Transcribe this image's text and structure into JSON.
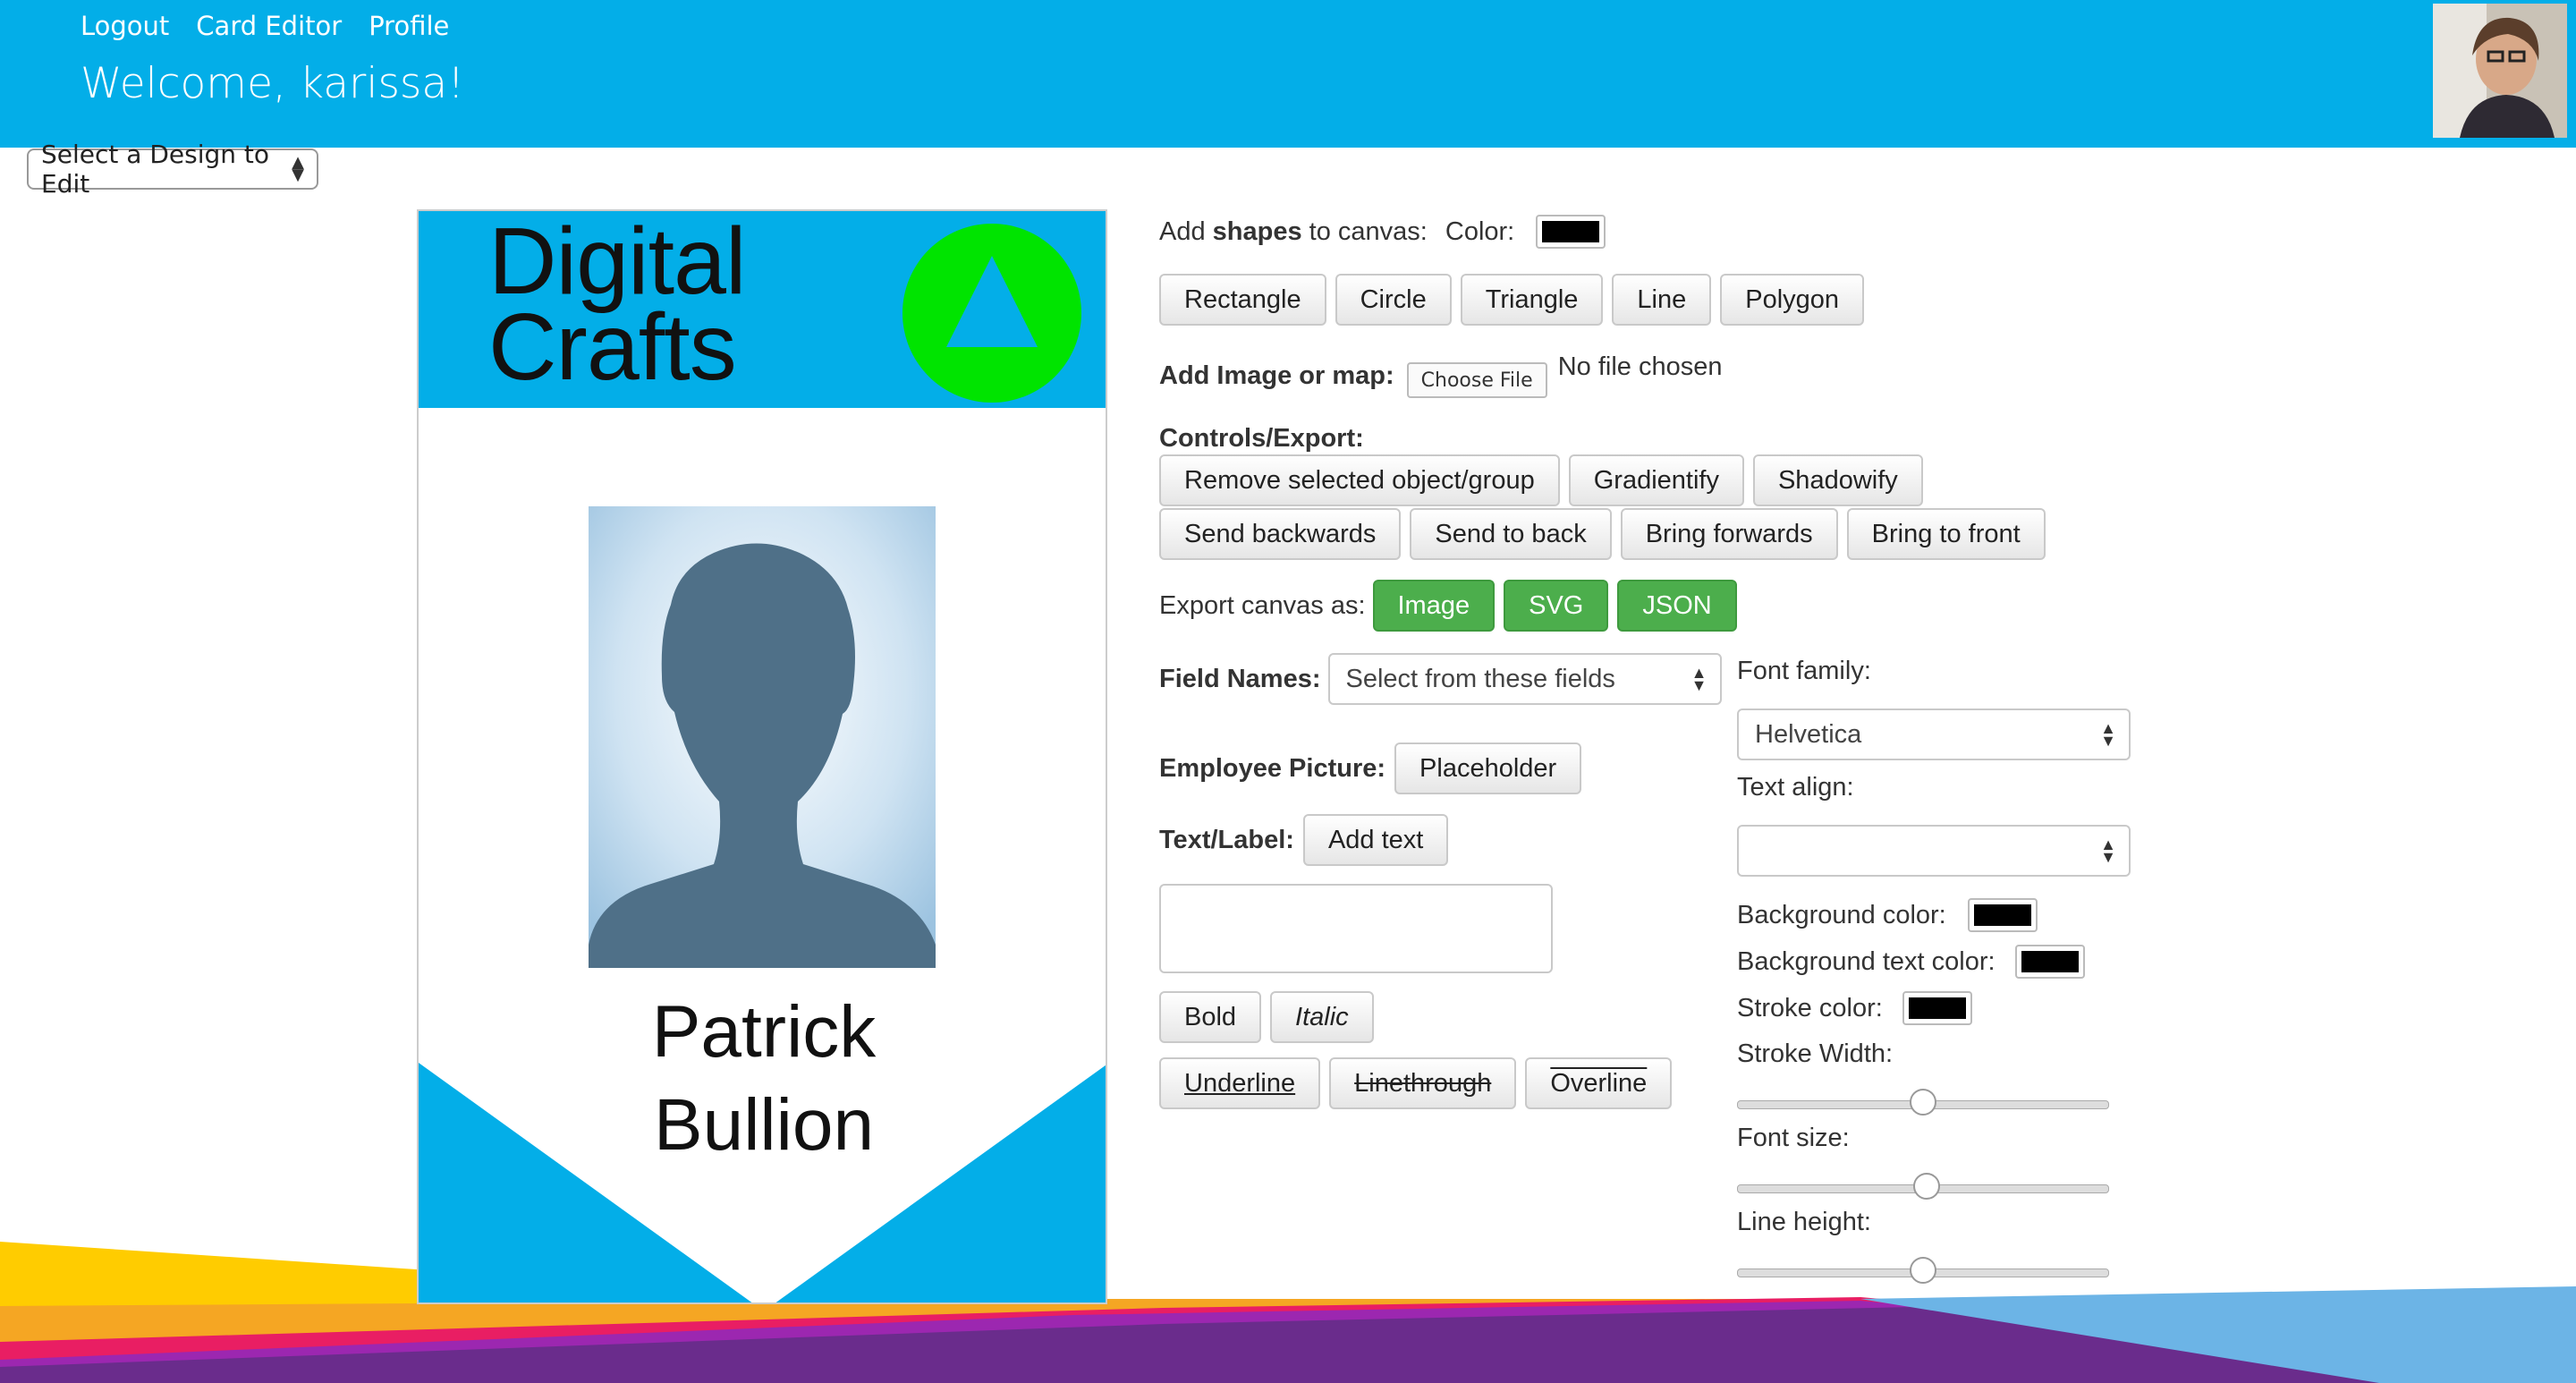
{
  "nav": {
    "logout": "Logout",
    "card_editor": "Card Editor",
    "profile": "Profile"
  },
  "welcome": "Welcome, karissa!",
  "design_select": {
    "value": "Select a Design to Edit"
  },
  "card": {
    "logo_line1": "Digital",
    "logo_line2": "Crafts",
    "name_line1": "Patrick",
    "name_line2": "Bullion",
    "colors": {
      "blue": "#03aee8",
      "green": "#00e400",
      "silhouette": "#4f7088"
    }
  },
  "shapes": {
    "label_prefix": "Add ",
    "label_bold": "shapes",
    "label_suffix": " to canvas:",
    "color_label": "Color:",
    "color": "#000000",
    "buttons": [
      "Rectangle",
      "Circle",
      "Triangle",
      "Line",
      "Polygon"
    ]
  },
  "image": {
    "label": "Add Image or map:",
    "choose_file": "Choose File",
    "no_file": "No file chosen"
  },
  "controls": {
    "label": "Controls/Export:",
    "row1": [
      "Remove selected object/group",
      "Gradientify",
      "Shadowify"
    ],
    "row2": [
      "Send backwards",
      "Send to back",
      "Bring forwards",
      "Bring to front"
    ]
  },
  "export": {
    "label": "Export canvas as:",
    "buttons": [
      "Image",
      "SVG",
      "JSON"
    ],
    "color": "#4cae4c"
  },
  "field_names": {
    "label": "Field Names:",
    "placeholder": "Select from these fields"
  },
  "employee_picture": {
    "label": "Employee Picture:",
    "button": "Placeholder"
  },
  "text_label": {
    "label": "Text/Label:",
    "button": "Add text"
  },
  "text_style": {
    "bold": "Bold",
    "italic": "Italic",
    "underline": "Underline",
    "linethrough": "Linethrough",
    "overline": "Overline"
  },
  "font_family": {
    "label": "Font family:",
    "value": "Helvetica"
  },
  "text_align": {
    "label": "Text align:",
    "value": ""
  },
  "colors": {
    "background_color": "Background color:",
    "background_text_color": "Background text color:",
    "stroke_color": "Stroke color:"
  },
  "sliders": {
    "stroke_width": {
      "label": "Stroke Width:",
      "value": 0.5
    },
    "font_size": {
      "label": "Font size:",
      "value": 0.51
    },
    "line_height": {
      "label": "Line height:",
      "value": 0.5
    }
  }
}
